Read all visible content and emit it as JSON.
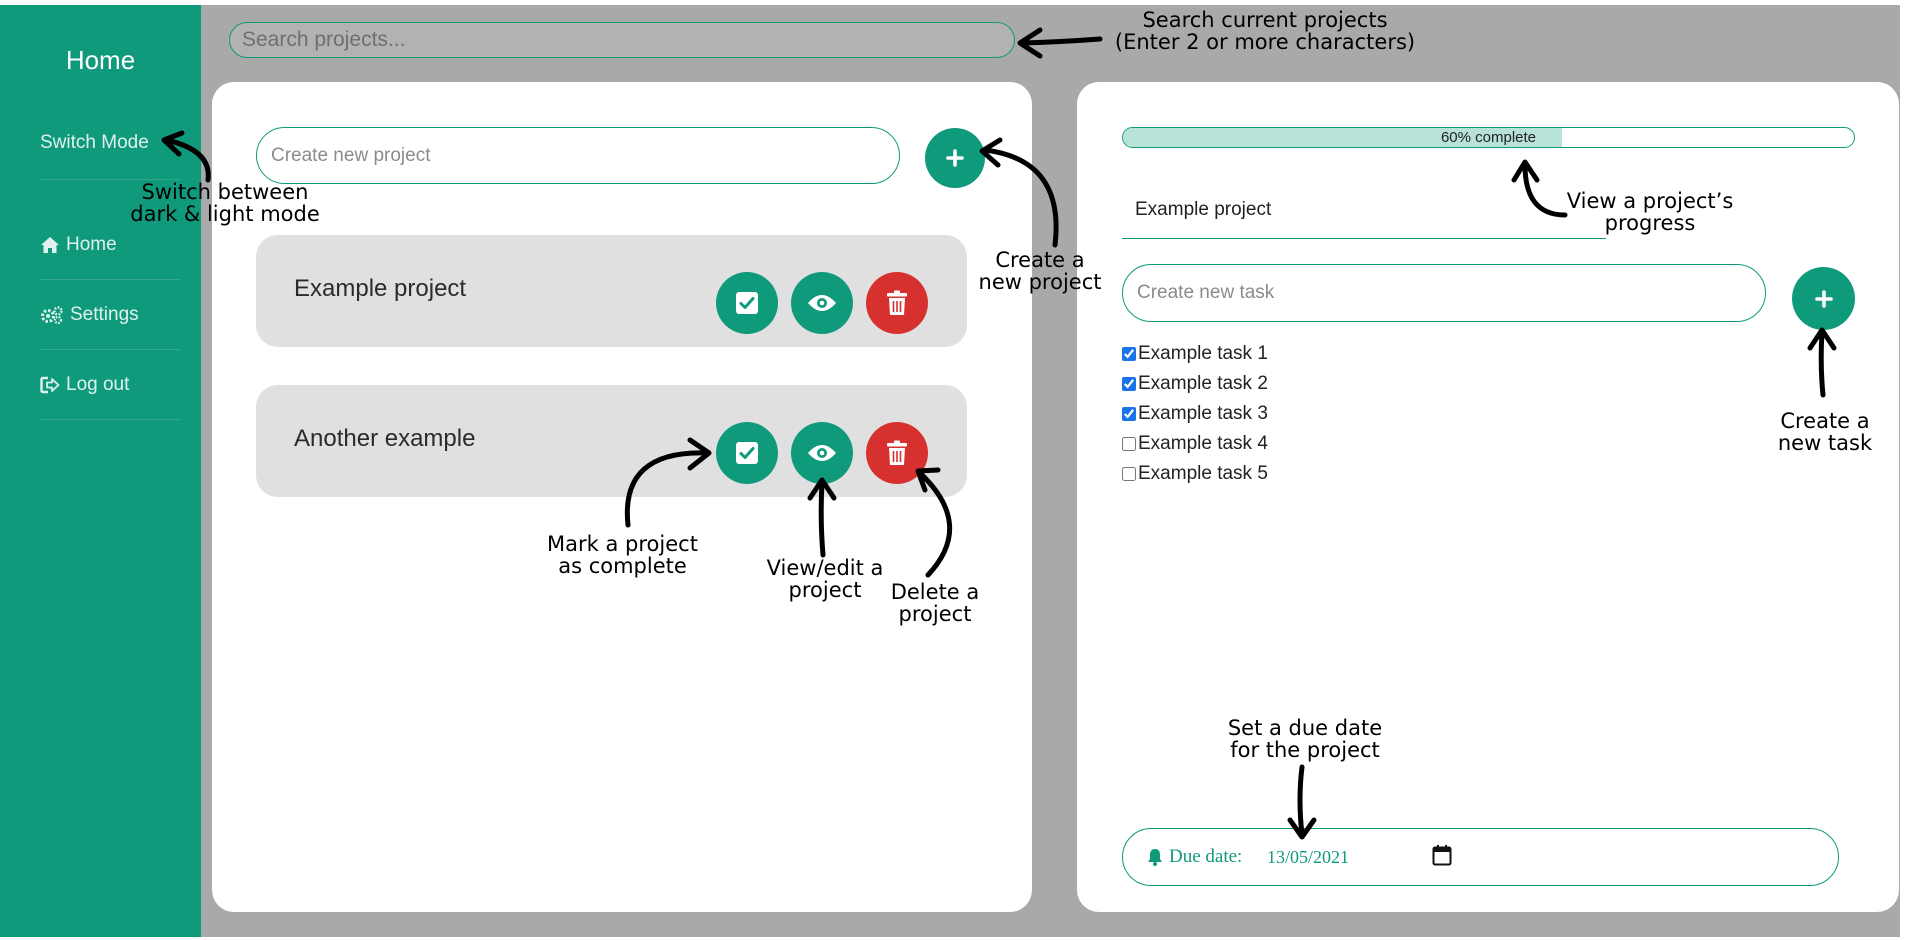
{
  "sidebar": {
    "title": "Home",
    "items": [
      {
        "label": "Switch Mode",
        "icon": ""
      },
      {
        "label": "Home",
        "icon": "home-icon"
      },
      {
        "label": "Settings",
        "icon": "gears-icon"
      },
      {
        "label": "Log out",
        "icon": "logout-icon"
      }
    ]
  },
  "search": {
    "placeholder": "Search projects..."
  },
  "projects_panel": {
    "new_project_placeholder": "Create new project",
    "add_icon": "plus-icon",
    "projects": [
      {
        "name": "Example project"
      },
      {
        "name": "Another example"
      }
    ]
  },
  "detail_panel": {
    "progress": {
      "percent": 60,
      "label": "60% complete"
    },
    "project_name": "Example project",
    "new_task_placeholder": "Create new task",
    "tasks": [
      {
        "label": "Example task 1",
        "checked": true
      },
      {
        "label": "Example task 2",
        "checked": true
      },
      {
        "label": "Example task 3",
        "checked": true
      },
      {
        "label": "Example task 4",
        "checked": false
      },
      {
        "label": "Example task 5",
        "checked": false
      }
    ],
    "due": {
      "label": "Due date:",
      "value": "13/05/2021"
    }
  },
  "annotations": {
    "search": "Search current projects\n(Enter 2 or more characters)",
    "switch_mode": "Switch between\ndark & light mode",
    "create_project": "Create a\nnew project",
    "progress": "View a project’s\nprogress",
    "create_task": "Create a\nnew task",
    "complete": "Mark a project\nas complete",
    "view_edit": "View/edit a\nproject",
    "delete": "Delete a\nproject",
    "due_date": "Set a due date\nfor the project"
  },
  "colors": {
    "accent": "#109a7c",
    "danger": "#d6312f",
    "frame": "#a9a9a9",
    "card": "#e0e0e0"
  }
}
